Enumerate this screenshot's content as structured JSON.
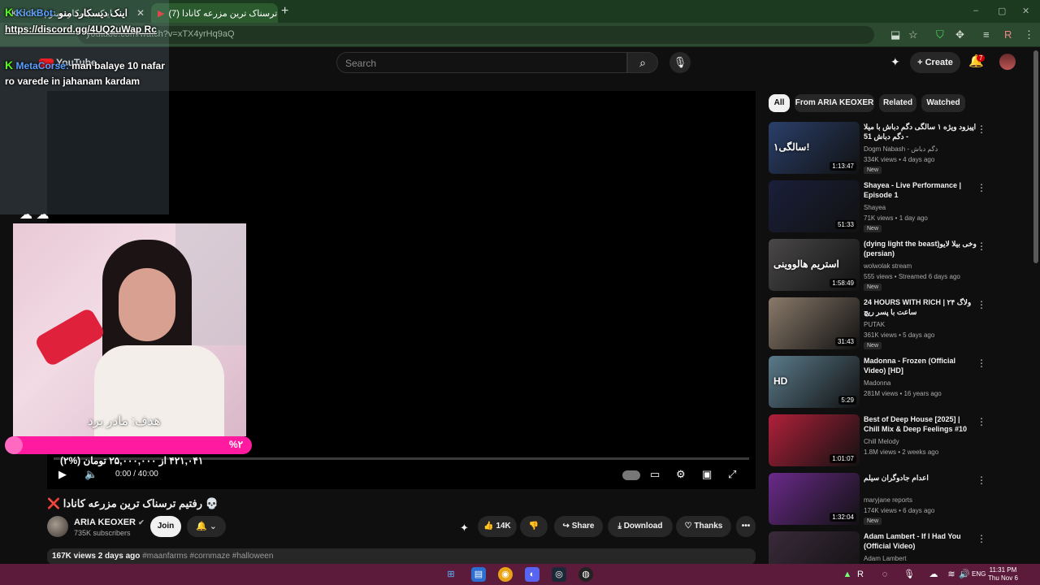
{
  "browser": {
    "tabs": [
      {
        "label": "KickBot | اینک دیسکارد منو"
      },
      {
        "label": "(7) رفتیم ترسناک ترین مزرعه کانادا"
      }
    ],
    "new_tab": "+",
    "url": "youtube.com/watch?v=xTX4yrHq9aQ",
    "window_controls": [
      "–",
      "▢",
      "✕"
    ]
  },
  "youtube": {
    "logo": "YouTube",
    "search_placeholder": "Search",
    "create_label": "Create",
    "notification_count": "7",
    "player": {
      "time": "0:00 / 40:00"
    },
    "video_title": "💀 رفتیم ترسناک ترین مزرعه کانادا ❌",
    "channel": {
      "name": "ARIA KEOXER",
      "subscribers": "735K subscribers"
    },
    "join_label": "Join",
    "likes": "14K",
    "share_label": "Share",
    "download_label": "Download",
    "thanks_label": "Thanks",
    "more_label": "•••",
    "description": {
      "stats": "167K views  2 days ago",
      "tags": "#maanfarms #cornmaze #halloween"
    },
    "chips": [
      "All",
      "From ARIA KEOXER",
      "Related",
      "Watched"
    ],
    "recommendations": [
      {
        "title": "اپیزود ویژه ۱ سالگی دگم دباش با میلا - دگم دباش 51",
        "channel": "Dogm Nabash - دگم دباش",
        "meta": "334K views • 4 days ago",
        "duration": "1:13:47",
        "new": "New",
        "thumb_text": "۱سالگی!"
      },
      {
        "title": "Shayea - Live Performance | Episode 1",
        "channel": "Shayea",
        "meta": "71K views • 1 day ago",
        "duration": "51:33",
        "new": "New",
        "thumb_text": ""
      },
      {
        "title": "(dying light the beast)وخی بیلا لایو (persian)",
        "channel": "wolwolak stream",
        "meta": "555 views • Streamed 6 days ago",
        "duration": "1:58:49",
        "new": "New",
        "thumb_text": "استریم هالووینی"
      },
      {
        "title": "24 HOURS WITH RICH | ولاگ ۲۴ ساعت با پسر ریچ",
        "channel": "PUTAK",
        "meta": "361K views • 5 days ago",
        "duration": "31:43",
        "new": "New",
        "thumb_text": ""
      },
      {
        "title": "Madonna - Frozen (Official Video) [HD]",
        "channel": "Madonna",
        "meta": "281M views • 16 years ago",
        "duration": "5:29",
        "new": "",
        "thumb_text": "HD"
      },
      {
        "title": "Best of Deep House [2025] | Chill Mix & Deep Feelings #10",
        "channel": "Chill Melody",
        "meta": "1.8M views • 2 weeks ago",
        "duration": "1:01:07",
        "new": "",
        "thumb_text": ""
      },
      {
        "title": "اعدام جادوگران سیلم",
        "channel": "maryjane reports",
        "meta": "174K views • 6 days ago",
        "duration": "1:32:04",
        "new": "New",
        "thumb_text": ""
      },
      {
        "title": "Adam Lambert - If I Had You (Official Video)",
        "channel": "Adam Lambert",
        "meta": "108M views • 15 years ago",
        "duration": "",
        "new": "",
        "thumb_text": ""
      }
    ]
  },
  "stream_overlay": {
    "bot_name": "KickBot:",
    "bot_text": "اینک دیسکارد منو",
    "discord": "https://discord.gg/4UQ2uWap Rc",
    "chat_user": "MetaCorse:",
    "chat_text": "man balaye 10 nafar ro varede in jahanam kardam",
    "goal_label": "هدف: مادر برد",
    "goal_percent": "%۲",
    "goal_fraction": 0.02,
    "goal_amount": "۴۲۱,۰۴۱ از ۲۵,۰۰۰,۰۰۰ تومان (%۲)"
  },
  "taskbar": {
    "lang": "ENG",
    "time": "11:31 PM",
    "date": "Thu Nov 6"
  },
  "colors": {
    "accent_pink": "#ff1aa0",
    "browser_green": "#2c4a2f",
    "taskbar": "#5d1b3c"
  }
}
